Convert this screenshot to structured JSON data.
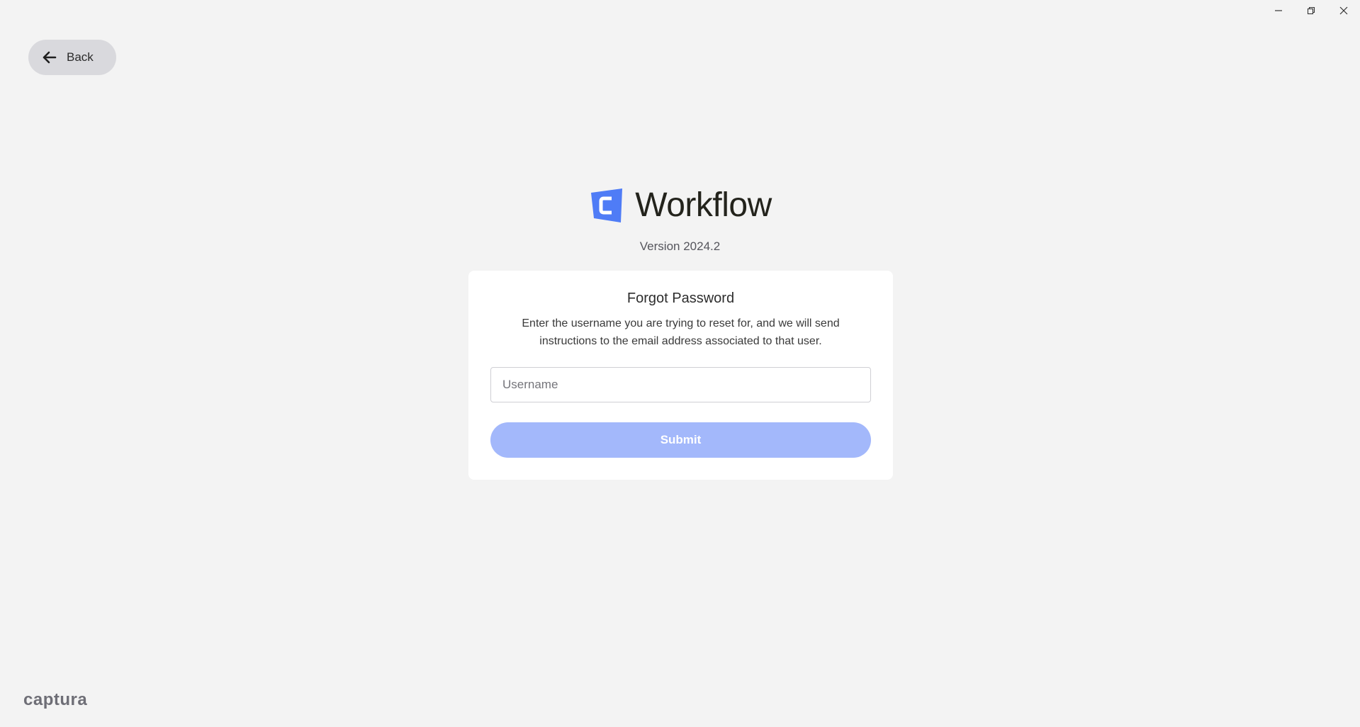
{
  "window": {
    "controls": [
      "minimize",
      "restore",
      "close"
    ]
  },
  "back": {
    "label": "Back",
    "icon": "arrow-left-icon"
  },
  "brand": {
    "name": "Workflow",
    "logo_icon": "workflow-logo-icon",
    "logo_color": "#4f7cf6",
    "version": "Version 2024.2"
  },
  "form": {
    "title": "Forgot Password",
    "description": "Enter the username you are trying to reset for, and we will send instructions to the email address associated to that user.",
    "username_placeholder": "Username",
    "username_value": "",
    "submit_label": "Submit",
    "submit_color": "#a3b8fb"
  },
  "footer": {
    "brand": "captura"
  }
}
